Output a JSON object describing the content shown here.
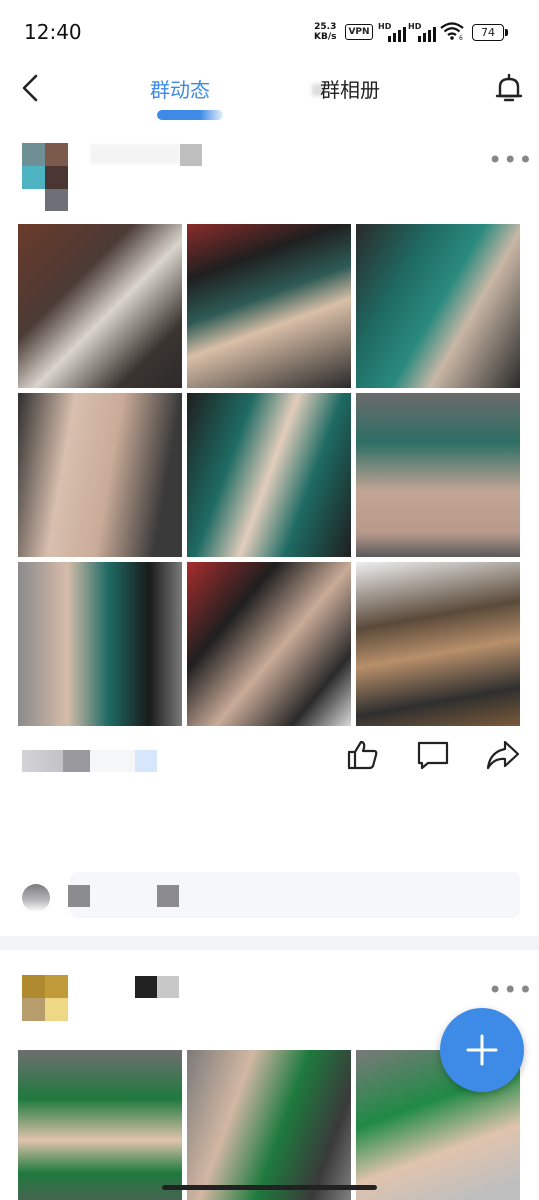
{
  "status_bar": {
    "time": "12:40",
    "speed_value": "25.3",
    "speed_unit": "KB/s",
    "vpn": "VPN",
    "hd1": "HD",
    "hd2": "HD",
    "wifi_sub": "6",
    "battery": "74"
  },
  "nav": {
    "tabs": [
      {
        "label": "群动态",
        "active": true
      },
      {
        "label": "群相册",
        "active": false
      }
    ],
    "back_icon": "chevron-left-icon",
    "bell_icon": "bell-icon"
  },
  "posts": [
    {
      "more": "•••",
      "photo_count": 9,
      "actions": [
        "thumbs-up-icon",
        "comment-icon",
        "share-icon"
      ]
    },
    {
      "more": "•••",
      "photo_count": 3
    }
  ],
  "fab": {
    "icon": "plus-icon",
    "symbol": "+"
  },
  "colors": {
    "accent": "#3d8be6",
    "text": "#222222",
    "divider": "#f2f3f5"
  }
}
